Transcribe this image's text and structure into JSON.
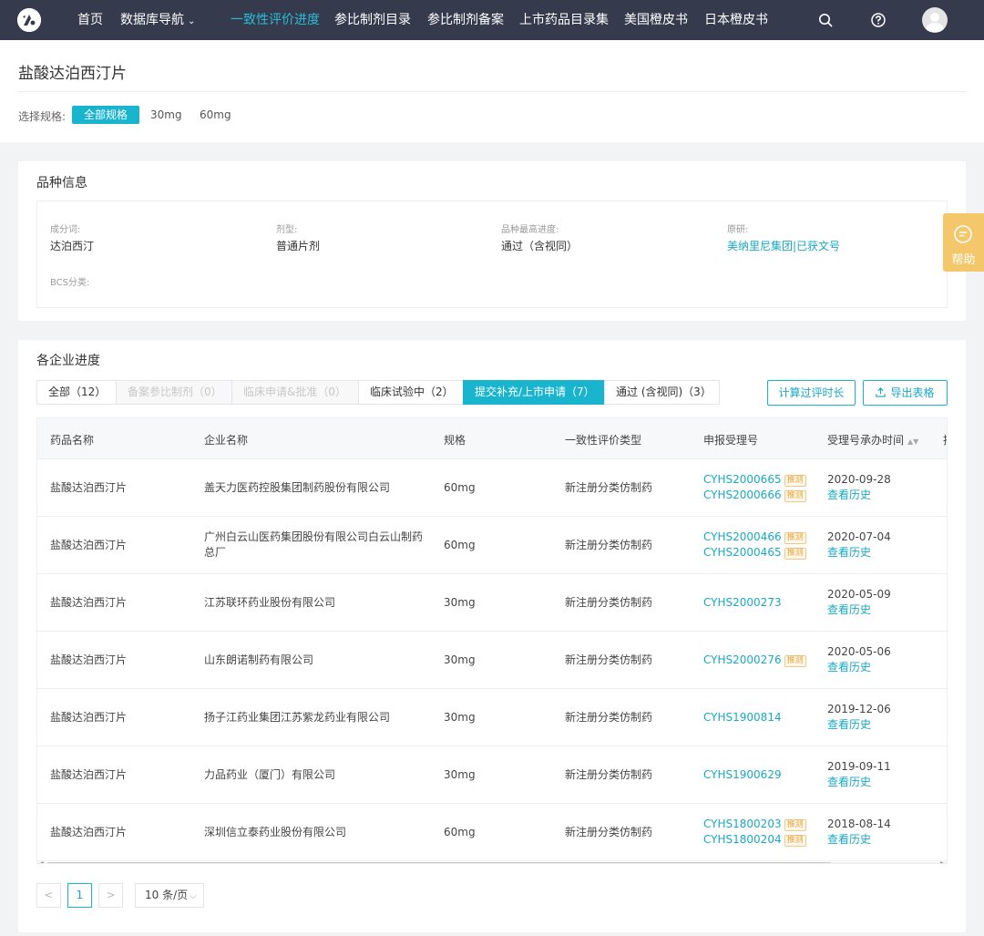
{
  "nav": {
    "items": [
      "首页",
      "数据库导航",
      "一致性评价进度",
      "参比制剂目录",
      "参比制剂备案",
      "上市药品目录集",
      "美国橙皮书",
      "日本橙皮书"
    ],
    "active_index": 2,
    "caret": "⌄",
    "accent": "#2bbdd6"
  },
  "header": {
    "title": "盐酸达泊西汀片",
    "spec_label": "选择规格:",
    "specs": [
      "全部规格",
      "30mg",
      "60mg"
    ]
  },
  "variety": {
    "title": "品种信息",
    "ingredient_label": "成分词:",
    "ingredient": "达泊西汀",
    "form_label": "剂型:",
    "form": "普通片剂",
    "progress_label": "品种最高进度:",
    "progress": "通过（含视同）",
    "origin_label": "原研:",
    "origin": "美纳里尼集团|已获文号",
    "bcs_label": "BCS分类:"
  },
  "help": {
    "label": "帮助"
  },
  "progress": {
    "title": "各企业进度",
    "tabs": [
      "全部（12）",
      "备案参比制剂（0）",
      "临床申请&批准（0）",
      "临床试验中（2）",
      "提交补充/上市申请（7）",
      "通过 (含视同)（3）"
    ],
    "btn_calc": "计算过评时长",
    "btn_export": "导出表格",
    "columns": [
      "药品名称",
      "企业名称",
      "规格",
      "一致性评价类型",
      "申报受理号",
      "受理号承办时间",
      "抽"
    ],
    "badge": "推测",
    "history_link": "查看历史",
    "rows": [
      {
        "drug": "盐酸达泊西汀片",
        "company": "盖天力医药控股集团制药股份有限公司",
        "company2": "",
        "spec": "60mg",
        "type": "新注册分类仿制药",
        "no1": "CYHS2000665",
        "no2": "CYHS2000666",
        "date": "2020-09-28"
      },
      {
        "drug": "盐酸达泊西汀片",
        "company": "广州白云山医药集团股份有限公司白云山制药",
        "company2": "总厂",
        "spec": "60mg",
        "type": "新注册分类仿制药",
        "no1": "CYHS2000466",
        "no2": "CYHS2000465",
        "date": "2020-07-04"
      },
      {
        "drug": "盐酸达泊西汀片",
        "company": "江苏联环药业股份有限公司",
        "company2": "",
        "spec": "30mg",
        "type": "新注册分类仿制药",
        "no1": "CYHS2000273",
        "no2": "",
        "date": "2020-05-09"
      },
      {
        "drug": "盐酸达泊西汀片",
        "company": "山东朗诺制药有限公司",
        "company2": "",
        "spec": "30mg",
        "type": "新注册分类仿制药",
        "no1": "CYHS2000276",
        "no2": "",
        "date": "2020-05-06"
      },
      {
        "drug": "盐酸达泊西汀片",
        "company": "扬子江药业集团江苏紫龙药业有限公司",
        "company2": "",
        "spec": "30mg",
        "type": "新注册分类仿制药",
        "no1": "CYHS1900814",
        "no2": "",
        "date": "2019-12-06"
      },
      {
        "drug": "盐酸达泊西汀片",
        "company": "力品药业（厦门）有限公司",
        "company2": "",
        "spec": "30mg",
        "type": "新注册分类仿制药",
        "no1": "CYHS1900629",
        "no2": "",
        "date": "2019-09-11"
      },
      {
        "drug": "盐酸达泊西汀片",
        "company": "深圳信立泰药业股份有限公司",
        "company2": "",
        "spec": "60mg",
        "type": "新注册分类仿制药",
        "no1": "CYHS1800203",
        "no2": "CYHS1800204",
        "date": "2018-08-14"
      }
    ],
    "badged": [
      [
        true,
        true
      ],
      [
        true,
        true
      ],
      [
        false,
        false
      ],
      [
        true,
        false
      ],
      [
        false,
        false
      ],
      [
        false,
        false
      ],
      [
        true,
        true
      ]
    ]
  },
  "pagination": {
    "prev": "<",
    "page": "1",
    "next": ">",
    "size": "10 条/页"
  }
}
